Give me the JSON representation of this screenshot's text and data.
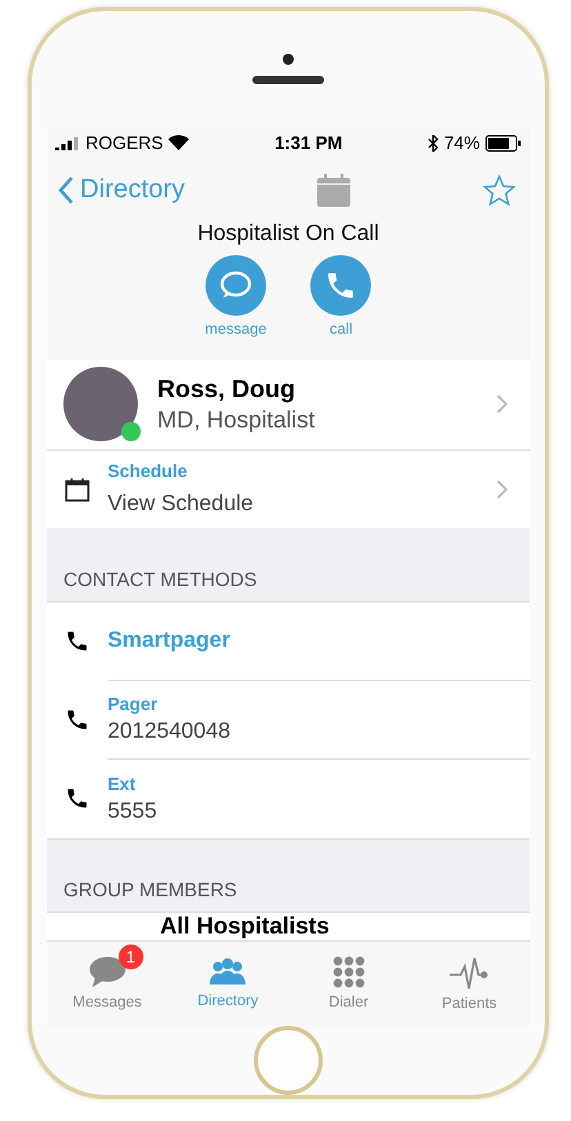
{
  "status_bar": {
    "carrier": "ROGERS",
    "time": "1:31 PM",
    "battery": "74%"
  },
  "nav": {
    "back": "Directory"
  },
  "header": {
    "title": "Hospitalist On Call",
    "actions": [
      {
        "kind": "message",
        "label": "message"
      },
      {
        "kind": "call",
        "label": "call"
      }
    ]
  },
  "profile": {
    "name": "Ross, Doug",
    "role": "MD, Hospitalist",
    "online": true
  },
  "schedule": {
    "label": "Schedule",
    "value": "View Schedule"
  },
  "contact_methods": {
    "title": "CONTACT METHODS",
    "items": [
      {
        "value": "Smartpager"
      },
      {
        "label": "Pager",
        "value": "2012540048"
      },
      {
        "label": "Ext",
        "value": "5555"
      }
    ]
  },
  "group_members": {
    "title": "GROUP MEMBERS",
    "items": [
      "All Hospitalists"
    ]
  },
  "tab_bar": [
    {
      "kind": "messages",
      "label": "Messages",
      "badge": "1",
      "selected": false
    },
    {
      "kind": "directory",
      "label": "Directory",
      "selected": true
    },
    {
      "kind": "dialer",
      "label": "Dialer",
      "selected": false
    },
    {
      "kind": "patients",
      "label": "Patients",
      "selected": false
    }
  ]
}
